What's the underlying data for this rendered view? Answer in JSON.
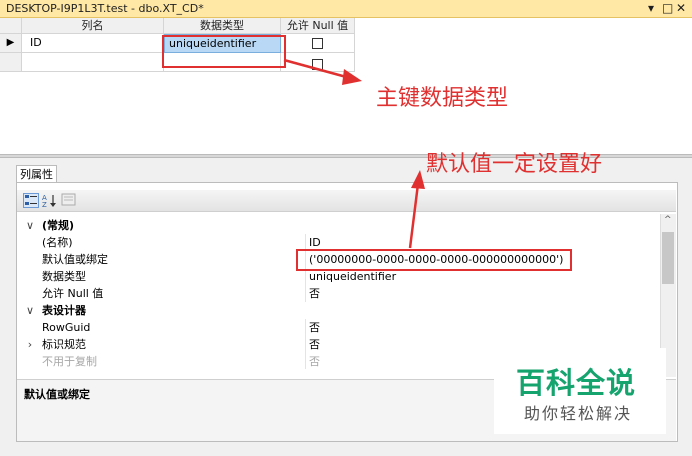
{
  "title": {
    "text": "DESKTOP-I9P1L3T.test - dbo.XT_CD*",
    "controls": [
      "▾",
      "□",
      "✕"
    ]
  },
  "grid": {
    "columns": [
      "列名",
      "数据类型",
      "允许 Null 值"
    ],
    "rows": [
      {
        "name": "ID",
        "type": "uniqueidentifier",
        "allow_null": false,
        "current": true
      },
      {
        "name": "",
        "type": "",
        "allow_null": false,
        "current": false
      }
    ]
  },
  "annotations": {
    "pk_note": "主键数据类型",
    "default_note": "默认值一定设置好"
  },
  "properties": {
    "tab_label": "列属性",
    "toolbar": [
      "categorized-view",
      "alphabetical-view",
      "property-pages"
    ],
    "rows": [
      {
        "kind": "category",
        "expander": "∨",
        "name": "(常规)",
        "value": ""
      },
      {
        "kind": "prop",
        "expander": "",
        "name": "(名称)",
        "value": "ID"
      },
      {
        "kind": "prop",
        "expander": "",
        "name": "默认值或绑定",
        "value": "('00000000-0000-0000-0000-000000000000')"
      },
      {
        "kind": "prop",
        "expander": "",
        "name": "数据类型",
        "value": "uniqueidentifier"
      },
      {
        "kind": "prop",
        "expander": "",
        "name": "允许 Null 值",
        "value": "否"
      },
      {
        "kind": "category",
        "expander": "∨",
        "name": "表设计器",
        "value": ""
      },
      {
        "kind": "prop",
        "expander": "",
        "name": "RowGuid",
        "value": "否"
      },
      {
        "kind": "prop",
        "expander": "›",
        "name": "标识规范",
        "value": "否"
      },
      {
        "kind": "dim",
        "expander": "",
        "name": "不用于复制",
        "value": "否"
      }
    ],
    "description_title": "默认值或绑定"
  },
  "watermark": {
    "line1": "百科全说",
    "line2": "助你轻松解决"
  },
  "colors": {
    "title_bg": "#ffe8a6",
    "selected_cell": "#b8d8f5",
    "annotation_red": "#e03030",
    "watermark_green": "#15a36e"
  }
}
